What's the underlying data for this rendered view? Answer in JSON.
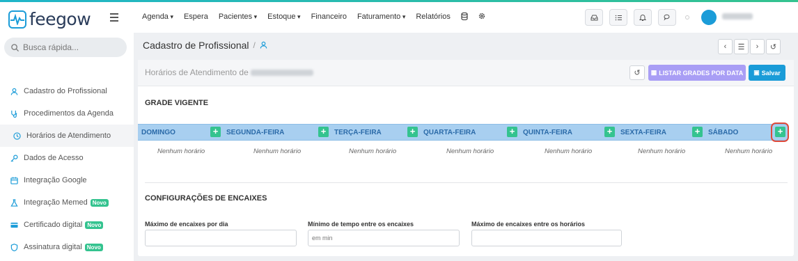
{
  "app": {
    "name": "feegow"
  },
  "search": {
    "placeholder": "Busca rápida..."
  },
  "sidebar": {
    "items": [
      {
        "label": "Cadastro do Profissional"
      },
      {
        "label": "Procedimentos da Agenda"
      },
      {
        "label": "Horários de Atendimento"
      },
      {
        "label": "Dados de Acesso"
      },
      {
        "label": "Integração Google"
      },
      {
        "label": "Integração Memed",
        "badge": "Novo"
      },
      {
        "label": "Certificado digital",
        "badge": "Novo"
      },
      {
        "label": "Assinatura digital",
        "badge": "Novo"
      }
    ]
  },
  "nav": {
    "items": [
      "Agenda",
      "Espera",
      "Pacientes",
      "Estoque",
      "Financeiro",
      "Faturamento",
      "Relatórios"
    ]
  },
  "breadcrumb": {
    "title": "Cadastro de Profissional",
    "separator": "/"
  },
  "card": {
    "title": "Horários de Atendimento de",
    "list_button": "LISTAR GRADES POR DATA",
    "save_button": "Salvar"
  },
  "grade": {
    "title": "GRADE VIGENTE",
    "days": [
      "DOMINGO",
      "SEGUNDA-FEIRA",
      "TERÇA-FEIRA",
      "QUARTA-FEIRA",
      "QUINTA-FEIRA",
      "SEXTA-FEIRA",
      "SÁBADO"
    ],
    "add_label": "+",
    "empty_text": "Nenhum horário"
  },
  "encaixes": {
    "title": "CONFIGURAÇÕES DE ENCAIXES",
    "fields": [
      {
        "label": "Máximo de encaixes por dia",
        "placeholder": ""
      },
      {
        "label": "Mínimo de tempo entre os encaixes",
        "placeholder": "em min"
      },
      {
        "label": "Máximo de encaixes entre os horários",
        "placeholder": ""
      }
    ]
  },
  "colors": {
    "brand": "#1b9cd8",
    "success": "#34c38f",
    "list_button": "#a99ef5",
    "day_bar": "#a8cff0",
    "highlight": "#e04a3a"
  }
}
